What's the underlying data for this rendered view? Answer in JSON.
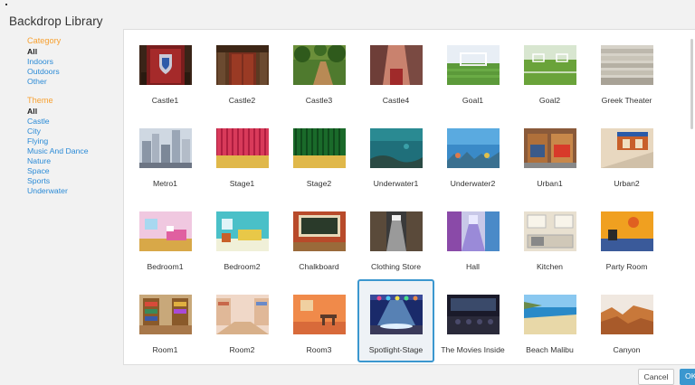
{
  "dialog": {
    "title": "Backdrop Library",
    "cancel_label": "Cancel",
    "ok_label": "OK"
  },
  "category": {
    "heading": "Category",
    "items": [
      {
        "label": "All",
        "selected": true
      },
      {
        "label": "Indoors",
        "selected": false
      },
      {
        "label": "Outdoors",
        "selected": false
      },
      {
        "label": "Other",
        "selected": false
      }
    ]
  },
  "theme": {
    "heading": "Theme",
    "items": [
      {
        "label": "All",
        "selected": true
      },
      {
        "label": "Castle",
        "selected": false
      },
      {
        "label": "City",
        "selected": false
      },
      {
        "label": "Flying",
        "selected": false
      },
      {
        "label": "Music And Dance",
        "selected": false
      },
      {
        "label": "Nature",
        "selected": false
      },
      {
        "label": "Space",
        "selected": false
      },
      {
        "label": "Sports",
        "selected": false
      },
      {
        "label": "Underwater",
        "selected": false
      }
    ]
  },
  "colors": {
    "accent": "#3b97cf",
    "section_heading": "#f7a030",
    "filter_link": "#2a8ad6"
  },
  "backdrops": [
    {
      "name": "Castle1",
      "icon": "castle-shield-icon"
    },
    {
      "name": "Castle2",
      "icon": "castle-door-icon"
    },
    {
      "name": "Castle3",
      "icon": "forest-path-icon"
    },
    {
      "name": "Castle4",
      "icon": "castle-hall-icon"
    },
    {
      "name": "Goal1",
      "icon": "soccer-goal-icon"
    },
    {
      "name": "Goal2",
      "icon": "soccer-field-icon"
    },
    {
      "name": "Greek Theater",
      "icon": "amphitheater-icon"
    },
    {
      "name": "Metro1",
      "icon": "city-skyline-icon"
    },
    {
      "name": "Stage1",
      "icon": "red-curtain-stage-icon"
    },
    {
      "name": "Stage2",
      "icon": "green-curtain-stage-icon"
    },
    {
      "name": "Underwater1",
      "icon": "underwater-icon"
    },
    {
      "name": "Underwater2",
      "icon": "coral-reef-icon"
    },
    {
      "name": "Urban1",
      "icon": "storefront-icon"
    },
    {
      "name": "Urban2",
      "icon": "street-corner-icon"
    },
    {
      "name": "Bedroom1",
      "icon": "bedroom-icon"
    },
    {
      "name": "Bedroom2",
      "icon": "bedroom-teal-icon"
    },
    {
      "name": "Chalkboard",
      "icon": "chalkboard-icon"
    },
    {
      "name": "Clothing Store",
      "icon": "store-aisle-icon"
    },
    {
      "name": "Hall",
      "icon": "hall-icon"
    },
    {
      "name": "Kitchen",
      "icon": "kitchen-icon"
    },
    {
      "name": "Party Room",
      "icon": "party-room-icon"
    },
    {
      "name": "Room1",
      "icon": "bookshelf-room-icon"
    },
    {
      "name": "Room2",
      "icon": "library-room-icon"
    },
    {
      "name": "Room3",
      "icon": "orange-room-icon"
    },
    {
      "name": "Spotlight-Stage",
      "icon": "spotlight-stage-icon",
      "selected": true
    },
    {
      "name": "The Movies Inside",
      "icon": "movie-theater-icon"
    },
    {
      "name": "Beach Malibu",
      "icon": "beach-icon"
    },
    {
      "name": "Canyon",
      "icon": "canyon-icon"
    }
  ]
}
